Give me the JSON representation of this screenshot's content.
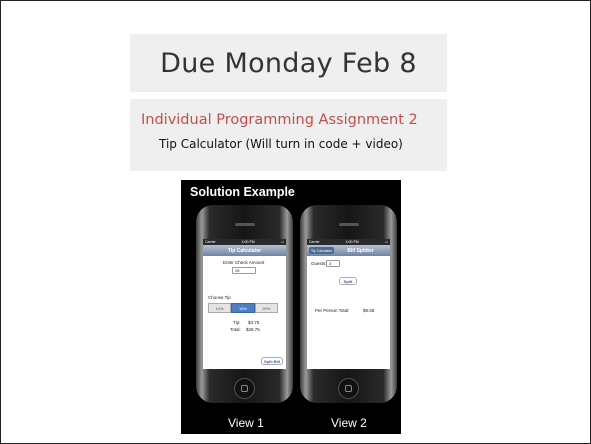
{
  "slide": {
    "title": "Due Monday Feb 8",
    "assignment_title": "Individual Programming Assignment 2",
    "assignment_desc": "Tip Calculator (Will turn  in code + video)",
    "colors": {
      "accent": "#c0504d",
      "band": "#efefef"
    }
  },
  "photo": {
    "heading": "Solution Example",
    "views": [
      "View 1",
      "View 2"
    ]
  },
  "screen1": {
    "status_carrier": "Carrier",
    "status_time": "4:00 PM",
    "nav_title": "Tip Calculator",
    "check_label": "Enter Check Amount",
    "check_value": "25",
    "choose_tip_label": "Choose Tip",
    "tip_options": [
      "10%",
      "15%",
      "20%"
    ],
    "tip_selected": "15%",
    "tip_label": "Tip:",
    "tip_value": "$3.75",
    "total_label": "Total:",
    "total_value": "$28.75",
    "split_button": "Split Bill"
  },
  "screen2": {
    "status_carrier": "Carrier",
    "status_time": "4:00 PM",
    "back_button": "Tip Calculator",
    "nav_title": "Bill Splitter",
    "guests_label": "Guests:",
    "guests_value": "3",
    "split_button": "Split",
    "per_person_label": "Per Person Total:",
    "per_person_value": "$9.58"
  }
}
